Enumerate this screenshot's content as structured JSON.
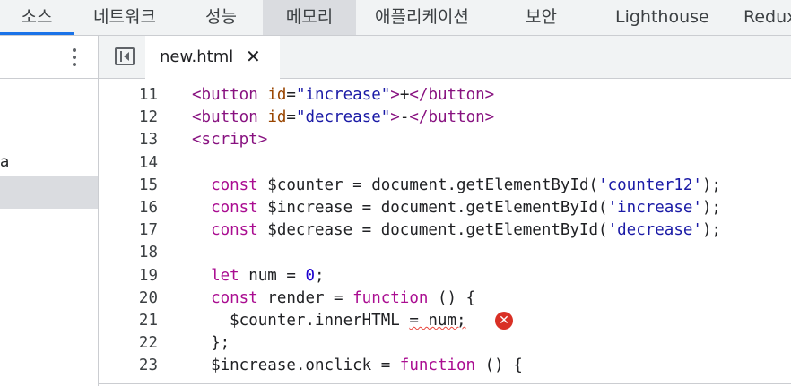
{
  "devtools_tabs": [
    "소스",
    "네트워크",
    "성능",
    "메모리",
    "애플리케이션",
    "보안",
    "Lighthouse",
    "Redux"
  ],
  "left_panel": {
    "items": [
      "a"
    ]
  },
  "editor": {
    "file_tab": "new.html",
    "close_glyph": "✕"
  },
  "code_lines": [
    {
      "n": "11",
      "html": "<span class='tag'>&lt;button</span> <span class='attr'>id</span>=<span class='str'>\"increase\"</span><span class='tag'>&gt;</span>+<span class='tag'>&lt;/button&gt;</span>"
    },
    {
      "n": "12",
      "html": "<span class='tag'>&lt;button</span> <span class='attr'>id</span>=<span class='str'>\"decrease\"</span><span class='tag'>&gt;</span>-<span class='tag'>&lt;/button&gt;</span>"
    },
    {
      "n": "13",
      "html": "<span class='tag'>&lt;script&gt;</span>"
    },
    {
      "n": "14",
      "html": ""
    },
    {
      "n": "15",
      "html": "  <span class='kw'>const</span> $counter = document.getElementById(<span class='str'>'counter12'</span>);"
    },
    {
      "n": "16",
      "html": "  <span class='kw'>const</span> $increase = document.getElementById(<span class='str'>'increase'</span>);"
    },
    {
      "n": "17",
      "html": "  <span class='kw'>const</span> $decrease = document.getElementById(<span class='str'>'decrease'</span>);"
    },
    {
      "n": "18",
      "html": ""
    },
    {
      "n": "19",
      "html": "  <span class='kw'>let</span> num = <span class='num'>0</span>;"
    },
    {
      "n": "20",
      "html": "  <span class='kw'>const</span> render = <span class='kw'>function</span> () {"
    },
    {
      "n": "21",
      "html": "    $counter.innerHTML <span class='err-underline'>= num;</span>"
    },
    {
      "n": "22",
      "html": "  };"
    },
    {
      "n": "23",
      "html": "  $increase.onclick = <span class='kw'>function</span> () {"
    }
  ],
  "error_icon_glyph": "✕"
}
